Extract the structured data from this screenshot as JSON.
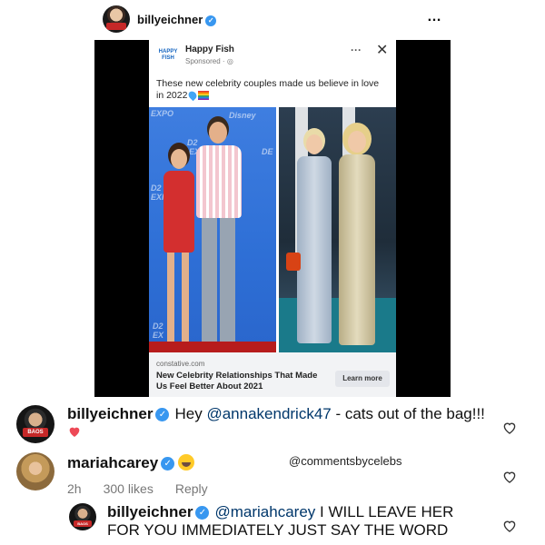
{
  "header": {
    "username": "billyeichner",
    "more_icon": "…"
  },
  "ad": {
    "logo_text": "HAPPY FISH",
    "page_name": "Happy Fish",
    "sponsored": "Sponsored · ",
    "more": "···",
    "close": "✕",
    "caption": "These new celebrity couples made us believe in love in 2022",
    "photo_left_logos": [
      "EXPO",
      "Disney",
      "D2",
      "EXP",
      "DE",
      "D2",
      "EXI",
      "D2",
      "EX"
    ],
    "domain": "constative.com",
    "headline": "New Celebrity Relationships That Made Us Feel Better About 2021",
    "cta": "Learn more"
  },
  "comments": [
    {
      "username": "billyeichner",
      "mention": "@annakendrick47",
      "text_before": "Hey ",
      "text_after": " - cats out of the bag!!!"
    },
    {
      "username": "mariahcarey",
      "time": "2h",
      "likes": "300 likes",
      "reply": "Reply"
    },
    {
      "username": "billyeichner",
      "mention": "@mariahcarey",
      "text_after": " I WILL LEAVE HER FOR YOU IMMEDIATELY JUST SAY THE WORD"
    }
  ],
  "watermark": "@commentsbycelebs",
  "colors": {
    "verified": "#3897f0",
    "mention": "#00376b",
    "heart": "#ed4956"
  }
}
